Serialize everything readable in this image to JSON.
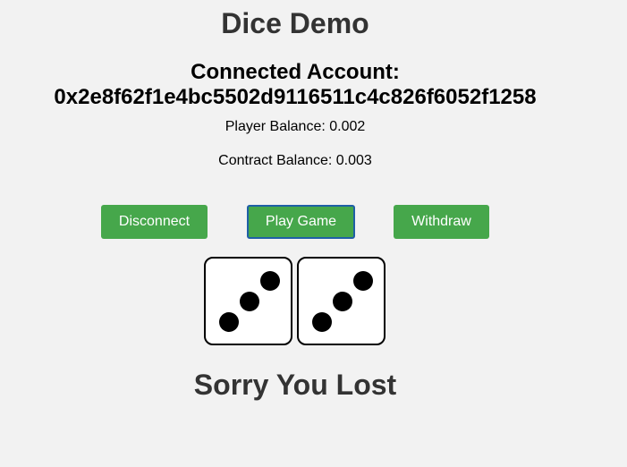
{
  "app": {
    "title": "Dice Demo"
  },
  "account": {
    "label": "Connected Account:",
    "address": "0x2e8f62f1e4bc5502d9116511c4c826f6052f1258"
  },
  "balances": {
    "player": "Player Balance: 0.002",
    "contract": "Contract Balance: 0.003"
  },
  "buttons": {
    "disconnect": "Disconnect",
    "play": "Play Game",
    "withdraw": "Withdraw"
  },
  "dice": {
    "values": [
      3,
      3
    ]
  },
  "result": {
    "message": "Sorry You Lost"
  },
  "colors": {
    "button": "#46a74b",
    "button_focus_border": "#1f5fa6",
    "background": "#f2f2f2"
  }
}
